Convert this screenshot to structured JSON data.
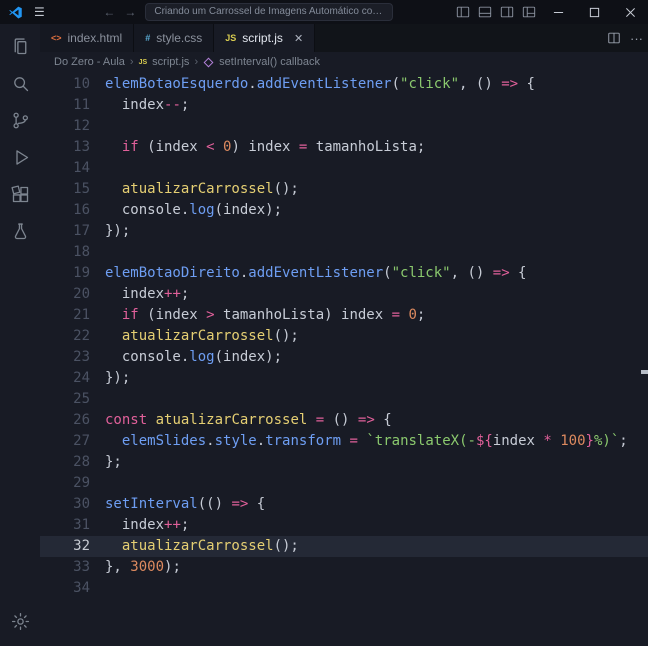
{
  "titlebar": {
    "title": "Criando um Carrossel de Imagens Automático com HTML, CSS..."
  },
  "icons": {
    "menu": "☰",
    "back": "←",
    "forward": "→",
    "close": "✕",
    "more": "···",
    "chevron": "›"
  },
  "tabs": [
    {
      "label": "index.html",
      "icon": "<>",
      "active": false
    },
    {
      "label": "style.css",
      "icon": "#",
      "active": false
    },
    {
      "label": "script.js",
      "icon": "JS",
      "active": true
    }
  ],
  "breadcrumb": {
    "folder": "Do Zero - Aula",
    "file_icon": "JS",
    "file": "script.js",
    "symbol": "setInterval() callback"
  },
  "editor": {
    "active_line": 32,
    "lines": [
      {
        "n": 10,
        "t": [
          [
            "v",
            "elemBotaoEsquerdo"
          ],
          [
            "d",
            "."
          ],
          [
            "v",
            "addEventListener"
          ],
          [
            "d",
            "("
          ],
          [
            "s",
            "\"click\""
          ],
          [
            "d",
            ", () "
          ],
          [
            "k",
            "=>"
          ],
          [
            "d",
            " {"
          ]
        ]
      },
      {
        "n": 11,
        "t": [
          [
            "d",
            "  index"
          ],
          [
            "k",
            "--"
          ],
          [
            "d",
            ";"
          ]
        ]
      },
      {
        "n": 12,
        "t": []
      },
      {
        "n": 13,
        "t": [
          [
            "d",
            "  "
          ],
          [
            "k",
            "if"
          ],
          [
            "d",
            " (index "
          ],
          [
            "k",
            "<"
          ],
          [
            "d",
            " "
          ],
          [
            "n",
            "0"
          ],
          [
            "d",
            ") index "
          ],
          [
            "k",
            "="
          ],
          [
            "d",
            " tamanhoLista;"
          ]
        ]
      },
      {
        "n": 14,
        "t": []
      },
      {
        "n": 15,
        "t": [
          [
            "d",
            "  "
          ],
          [
            "f",
            "atualizarCarrossel"
          ],
          [
            "d",
            "();"
          ]
        ]
      },
      {
        "n": 16,
        "t": [
          [
            "d",
            "  console."
          ],
          [
            "v",
            "log"
          ],
          [
            "d",
            "(index);"
          ]
        ]
      },
      {
        "n": 17,
        "t": [
          [
            "d",
            "});"
          ]
        ]
      },
      {
        "n": 18,
        "t": []
      },
      {
        "n": 19,
        "t": [
          [
            "v",
            "elemBotaoDireito"
          ],
          [
            "d",
            "."
          ],
          [
            "v",
            "addEventListener"
          ],
          [
            "d",
            "("
          ],
          [
            "s",
            "\"click\""
          ],
          [
            "d",
            ", () "
          ],
          [
            "k",
            "=>"
          ],
          [
            "d",
            " {"
          ]
        ]
      },
      {
        "n": 20,
        "t": [
          [
            "d",
            "  index"
          ],
          [
            "k",
            "++"
          ],
          [
            "d",
            ";"
          ]
        ]
      },
      {
        "n": 21,
        "t": [
          [
            "d",
            "  "
          ],
          [
            "k",
            "if"
          ],
          [
            "d",
            " (index "
          ],
          [
            "k",
            ">"
          ],
          [
            "d",
            " tamanhoLista) index "
          ],
          [
            "k",
            "="
          ],
          [
            "d",
            " "
          ],
          [
            "n",
            "0"
          ],
          [
            "d",
            ";"
          ]
        ]
      },
      {
        "n": 22,
        "t": [
          [
            "d",
            "  "
          ],
          [
            "f",
            "atualizarCarrossel"
          ],
          [
            "d",
            "();"
          ]
        ]
      },
      {
        "n": 23,
        "t": [
          [
            "d",
            "  console."
          ],
          [
            "v",
            "log"
          ],
          [
            "d",
            "(index);"
          ]
        ]
      },
      {
        "n": 24,
        "t": [
          [
            "d",
            "});"
          ]
        ]
      },
      {
        "n": 25,
        "t": []
      },
      {
        "n": 26,
        "t": [
          [
            "k",
            "const"
          ],
          [
            "d",
            " "
          ],
          [
            "f",
            "atualizarCarrossel"
          ],
          [
            "d",
            " "
          ],
          [
            "k",
            "="
          ],
          [
            "d",
            " () "
          ],
          [
            "k",
            "=>"
          ],
          [
            "d",
            " {"
          ]
        ]
      },
      {
        "n": 27,
        "t": [
          [
            "d",
            "  "
          ],
          [
            "v",
            "elemSlides"
          ],
          [
            "d",
            "."
          ],
          [
            "v",
            "style"
          ],
          [
            "d",
            "."
          ],
          [
            "v",
            "transform"
          ],
          [
            "d",
            " "
          ],
          [
            "k",
            "="
          ],
          [
            "d",
            " "
          ],
          [
            "s",
            "`translateX(-"
          ],
          [
            "k",
            "${"
          ],
          [
            "d",
            "index "
          ],
          [
            "k",
            "*"
          ],
          [
            "d",
            " "
          ],
          [
            "n",
            "100"
          ],
          [
            "k",
            "}"
          ],
          [
            "s",
            "%)`"
          ],
          [
            "d",
            ";"
          ]
        ]
      },
      {
        "n": 28,
        "t": [
          [
            "d",
            "};"
          ]
        ]
      },
      {
        "n": 29,
        "t": []
      },
      {
        "n": 30,
        "t": [
          [
            "v",
            "setInterval"
          ],
          [
            "d",
            "(() "
          ],
          [
            "k",
            "=>"
          ],
          [
            "d",
            " {"
          ]
        ]
      },
      {
        "n": 31,
        "t": [
          [
            "d",
            "  index"
          ],
          [
            "k",
            "++"
          ],
          [
            "d",
            ";"
          ]
        ]
      },
      {
        "n": 32,
        "t": [
          [
            "d",
            "  "
          ],
          [
            "f",
            "atualizarCarrossel"
          ],
          [
            "d",
            "();"
          ]
        ]
      },
      {
        "n": 33,
        "t": [
          [
            "d",
            "}, "
          ],
          [
            "n",
            "3000"
          ],
          [
            "d",
            ");"
          ]
        ]
      },
      {
        "n": 34,
        "t": []
      }
    ]
  },
  "colors": {
    "editor_bg": "#181b25",
    "line_highlight": "#242936",
    "line_number": "#4b5263",
    "line_number_active": "#c6cad2",
    "code_default": "#c7ccd6",
    "code_variable": "#6e9ef3",
    "code_function": "#e5cf73",
    "code_keyword": "#e0609a",
    "code_string": "#8bc96e",
    "code_number": "#dd8a5f",
    "logo_accent": "#2196f3"
  }
}
